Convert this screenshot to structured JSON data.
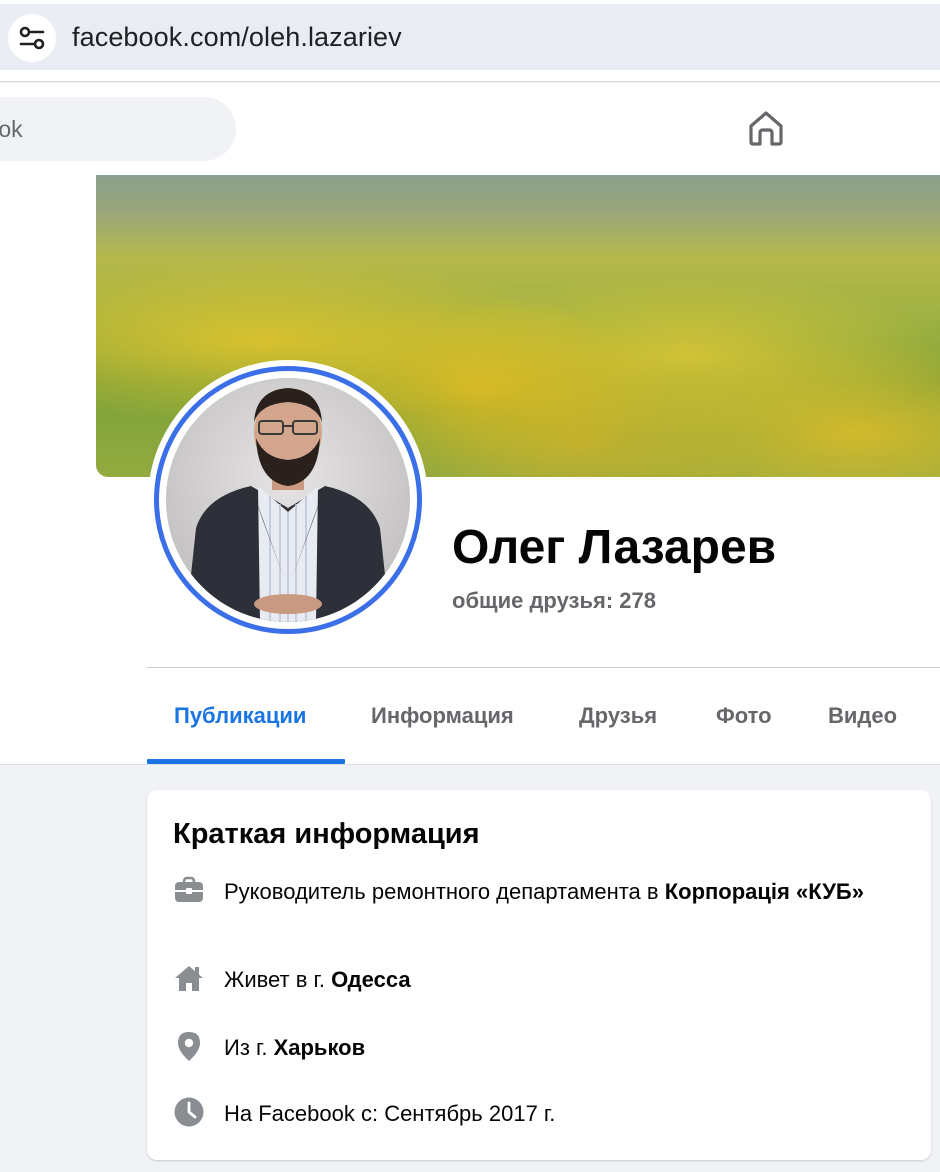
{
  "browser": {
    "url": "facebook.com/oleh.lazariev",
    "site_settings_icon": "tune-icon"
  },
  "header": {
    "search_text": "ebook",
    "home_icon": "home-icon"
  },
  "profile": {
    "name": "Олег Лазарев",
    "mutual_friends": "общие друзья: 278",
    "accent_color": "#1b74e4",
    "avatar_ring_color": "#3b6fe8"
  },
  "tabs": [
    {
      "label": "Публикации",
      "active": true
    },
    {
      "label": "Информация",
      "active": false
    },
    {
      "label": "Друзья",
      "active": false
    },
    {
      "label": "Фото",
      "active": false
    },
    {
      "label": "Видео",
      "active": false
    }
  ],
  "intro": {
    "title": "Краткая информация",
    "items": [
      {
        "icon": "briefcase-icon",
        "prefix": "Руководитель ремонтного департамента в ",
        "bold": "Корпорація «КУБ»"
      },
      {
        "icon": "house-icon",
        "prefix": "Живет в г. ",
        "bold": "Одесса"
      },
      {
        "icon": "location-pin-icon",
        "prefix": "Из г. ",
        "bold": "Харьков"
      },
      {
        "icon": "clock-icon",
        "prefix": "На Facebook с: Сентябрь 2017 г.",
        "bold": ""
      }
    ]
  }
}
